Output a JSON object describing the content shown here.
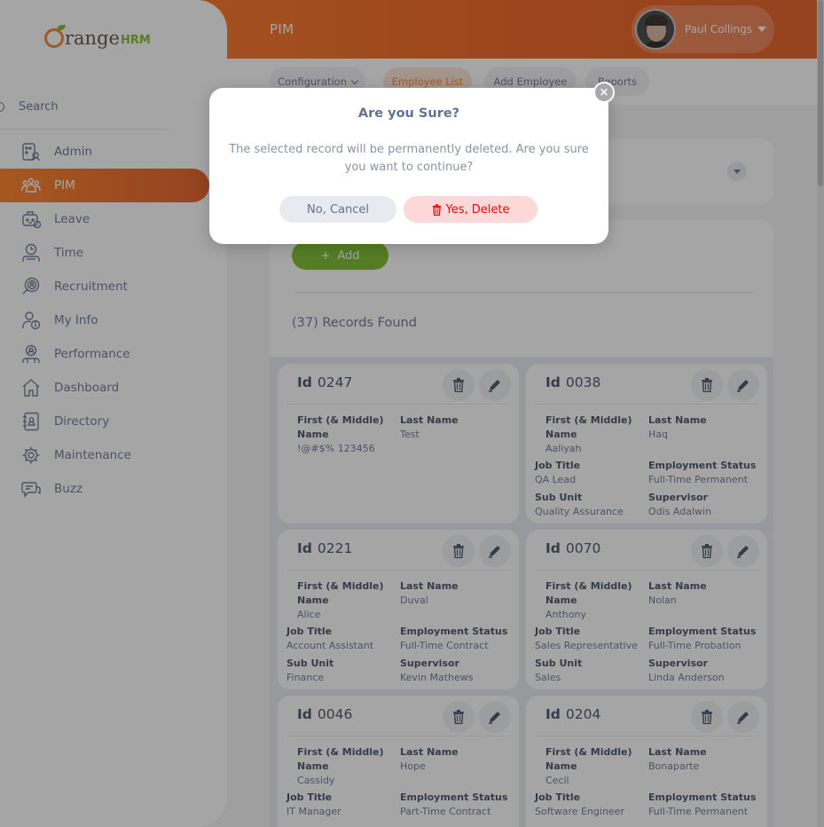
{
  "topbar": {
    "module_title": "PIM",
    "user_name": "Paul Collings"
  },
  "subnav": {
    "tabs": [
      {
        "label": "Configuration",
        "has_dropdown": true
      },
      {
        "label": "Employee List",
        "active": true
      },
      {
        "label": "Add Employee"
      },
      {
        "label": "Reports"
      }
    ]
  },
  "sidebar": {
    "logo_text_1": "range",
    "logo_text_2": "HRM",
    "search_placeholder": "Search",
    "items": [
      {
        "label": "Admin",
        "icon": "admin-icon"
      },
      {
        "label": "PIM",
        "icon": "pim-icon",
        "active": true
      },
      {
        "label": "Leave",
        "icon": "leave-icon"
      },
      {
        "label": "Time",
        "icon": "time-icon"
      },
      {
        "label": "Recruitment",
        "icon": "recruitment-icon"
      },
      {
        "label": "My Info",
        "icon": "my-info-icon"
      },
      {
        "label": "Performance",
        "icon": "performance-icon"
      },
      {
        "label": "Dashboard",
        "icon": "dashboard-icon"
      },
      {
        "label": "Directory",
        "icon": "directory-icon"
      },
      {
        "label": "Maintenance",
        "icon": "maintenance-icon"
      },
      {
        "label": "Buzz",
        "icon": "buzz-icon"
      }
    ]
  },
  "main": {
    "add_label": "Add",
    "records_found": "(37) Records Found",
    "labels": {
      "id": "Id",
      "first_middle_1": "First (& Middle)",
      "first_middle_2": "Name",
      "last_name": "Last Name",
      "job_title": "Job Title",
      "employment_status": "Employment Status",
      "sub_unit": "Sub Unit",
      "supervisor": "Supervisor"
    },
    "employees": [
      {
        "id": "0247",
        "first": "!@#$% 123456",
        "last": "Test",
        "job": "",
        "status": "",
        "sub_unit": "",
        "supervisor": ""
      },
      {
        "id": "0038",
        "first": "Aaliyah",
        "last": "Haq",
        "job": "QA Lead",
        "status": "Full-Time Permanent",
        "sub_unit": "Quality Assurance",
        "supervisor": "Odis Adalwin"
      },
      {
        "id": "0221",
        "first": "Alice",
        "last": "Duval",
        "job": "Account Assistant",
        "status": "Full-Time Contract",
        "sub_unit": "Finance",
        "supervisor": "Kevin Mathews"
      },
      {
        "id": "0070",
        "first": "Anthony",
        "last": "Nolan",
        "job": "Sales Representative",
        "status": "Full-Time Probation",
        "sub_unit": "Sales",
        "supervisor": "Linda Anderson"
      },
      {
        "id": "0046",
        "first": "Cassidy",
        "last": "Hope",
        "job": "IT Manager",
        "status": "Part-Time Contract",
        "sub_unit": "",
        "supervisor": ""
      },
      {
        "id": "0204",
        "first": "Cecil",
        "last": "Bonaparte",
        "job": "Software Engineer",
        "status": "Full-Time Permanent",
        "sub_unit": "",
        "supervisor": ""
      }
    ]
  },
  "dialog": {
    "title": "Are you Sure?",
    "message": "The selected record will be permanently deleted. Are you sure you want to continue?",
    "cancel_label": "No, Cancel",
    "delete_label": "Yes, Delete",
    "close_glyph": "×"
  },
  "colors": {
    "brand_orange": "#ff7b1d",
    "brand_green": "#76bc21",
    "danger": "#eb0910"
  }
}
